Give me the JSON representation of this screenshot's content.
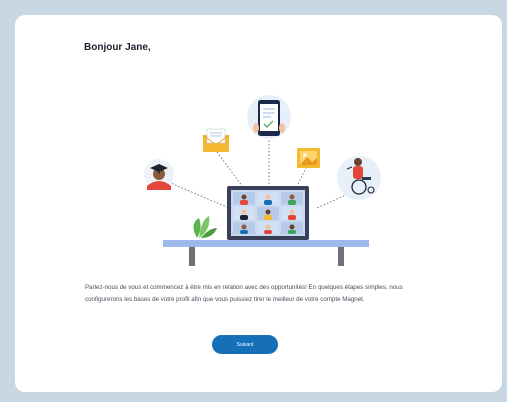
{
  "greeting": "Bonjour Jane,",
  "intro_text": "Parlez-nous de vous et commencez à être mis en relation avec des opportunités! En quelques étapes simples, nous configurerons les bases de votre profil afin que vous puissiez tirer le meilleur de votre compte Magnet.",
  "next_button_label": "Suivant",
  "colors": {
    "background": "#c7d7e3",
    "card": "#ffffff",
    "primary": "#1570b8",
    "desk": "#9fb8ec",
    "accent_yellow": "#f4b931"
  },
  "illustration": {
    "icons": [
      "graduate-avatar-icon",
      "email-envelope-icon",
      "tablet-document-icon",
      "image-frame-icon",
      "wheelchair-user-icon",
      "laptop-video-call-icon",
      "plant-icon",
      "desk-icon"
    ]
  }
}
